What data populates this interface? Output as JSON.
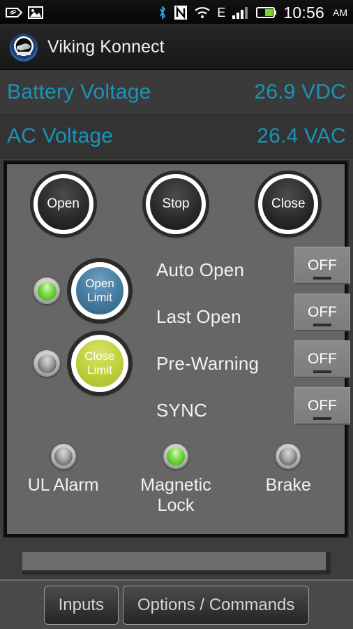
{
  "statusbar": {
    "time": "10:56",
    "ampm": "AM",
    "icons": [
      "eco-leaf-icon",
      "image-icon",
      "bluetooth-icon",
      "nfc-icon",
      "wifi-icon",
      "edge-network-icon",
      "signal-bars-icon",
      "battery-icon"
    ],
    "network_label": "E"
  },
  "actionbar": {
    "title": "Viking Konnect",
    "logo": "viking-konnect-logo"
  },
  "readouts": [
    {
      "label": "Battery Voltage",
      "value": "26.9 VDC"
    },
    {
      "label": "AC Voltage",
      "value": "26.4 VAC"
    }
  ],
  "panel": {
    "controls": [
      {
        "label": "Open",
        "name": "open-button"
      },
      {
        "label": "Stop",
        "name": "stop-button"
      },
      {
        "label": "Close",
        "name": "close-button"
      }
    ],
    "limits": [
      {
        "label_line1": "Open",
        "label_line2": "Limit",
        "led_state": "on",
        "color": "#4a7fa4"
      },
      {
        "label_line1": "Close",
        "label_line2": "Limit",
        "led_state": "off",
        "color": "#c3d340"
      }
    ],
    "options": [
      {
        "label": "Auto Open",
        "value": "OFF"
      },
      {
        "label": "Last Open",
        "value": "OFF"
      },
      {
        "label": "Pre-Warning",
        "value": "OFF"
      },
      {
        "label": "SYNC",
        "value": "OFF"
      }
    ],
    "status_leds": [
      {
        "label": "UL Alarm",
        "state": "off"
      },
      {
        "label": "Magnetic\nLock",
        "state": "on"
      },
      {
        "label": "Brake",
        "state": "off"
      }
    ]
  },
  "bottombar": {
    "buttons": [
      {
        "label": "Inputs"
      },
      {
        "label": "Options / Commands"
      }
    ]
  },
  "colors": {
    "readout_text": "#1a93b7",
    "led_on": "#4cc121",
    "led_off": "#8a8a8a",
    "open_limit": "#4a7fa4",
    "close_limit": "#c3d340",
    "panel_bg": "#666666"
  }
}
